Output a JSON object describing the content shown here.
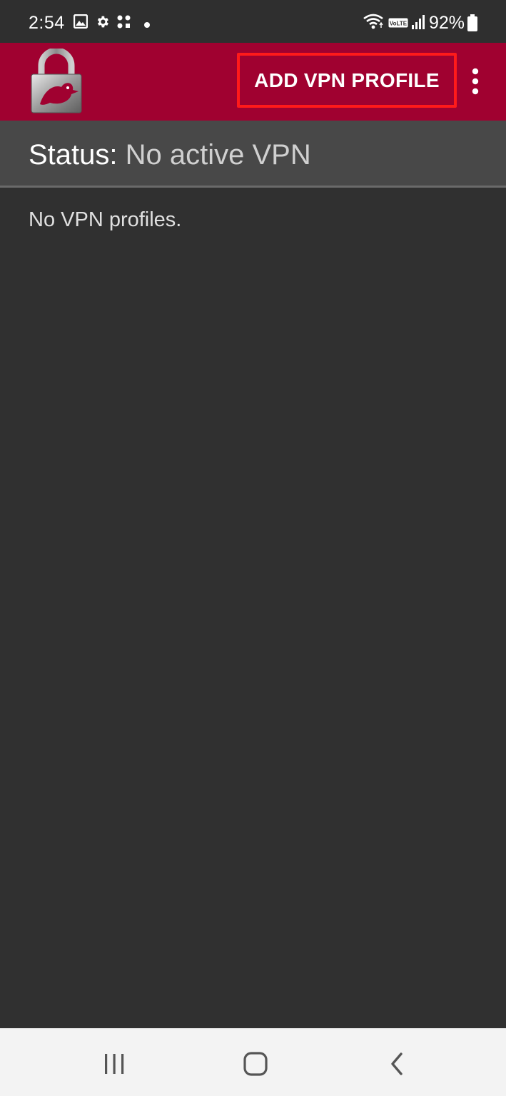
{
  "status_bar": {
    "time": "2:54",
    "battery_percent": "92%",
    "icons": [
      "gallery-icon",
      "settings-gear-icon",
      "apps-icon",
      "notification-dot-icon",
      "wifi-icon",
      "volte-icon",
      "signal-icon",
      "battery-icon"
    ]
  },
  "app_bar": {
    "logo": "padlock-logo-icon",
    "add_vpn_label": "ADD VPN PROFILE",
    "menu_icon": "more-vert-icon"
  },
  "status_header": {
    "label": "Status:",
    "value": "No active VPN"
  },
  "content": {
    "empty_message": "No VPN profiles."
  },
  "nav_bar": {
    "icons": [
      "recent-apps-icon",
      "home-icon",
      "back-icon"
    ]
  },
  "colors": {
    "app_bar": "#a00130",
    "background": "#303030",
    "status_header": "#484848",
    "highlight_border": "#ff1a1a",
    "nav_bar": "#f3f3f3"
  }
}
